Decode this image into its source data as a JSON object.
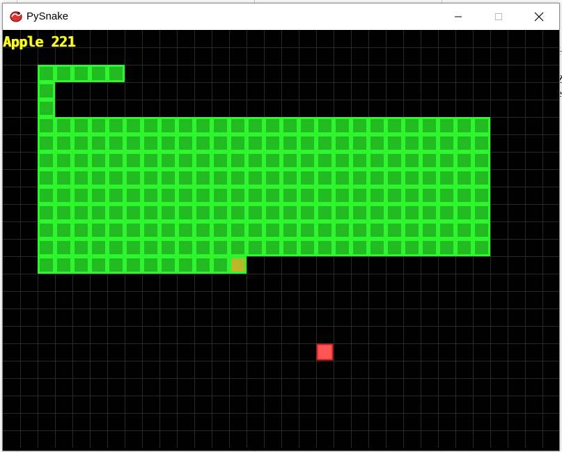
{
  "window": {
    "title": "PySnake",
    "icon": "snake-app-icon",
    "controls": [
      "minimize-icon",
      "maximize-icon",
      "close-icon"
    ]
  },
  "hud": {
    "label": "Apple",
    "count": "221",
    "text": "Apple 221",
    "color": "#ffff22"
  },
  "game": {
    "grid": {
      "cols": 32,
      "rows": 24
    },
    "colors": {
      "background": "#000000",
      "grid_line": "#2a2a2a",
      "snake_fill": "#22bb22",
      "snake_edge": "#2ef52e",
      "head_fill": "#b8b82a",
      "apple_fill": "#ff5555",
      "apple_edge": "#cc2222"
    },
    "snake_rows": [
      [
        2,
        2,
        6
      ],
      [
        3,
        2,
        2
      ],
      [
        4,
        2,
        2
      ],
      [
        5,
        2,
        27
      ],
      [
        6,
        2,
        27
      ],
      [
        7,
        2,
        27
      ],
      [
        8,
        2,
        27
      ],
      [
        9,
        2,
        27
      ],
      [
        10,
        2,
        27
      ],
      [
        11,
        2,
        27
      ],
      [
        12,
        2,
        27
      ],
      [
        13,
        2,
        13
      ]
    ],
    "head": {
      "col": 13,
      "row": 13
    },
    "apple": {
      "col": 18,
      "row": 18
    }
  },
  "background_app": {
    "fragments": [
      "H",
      "Z",
      "e"
    ]
  }
}
